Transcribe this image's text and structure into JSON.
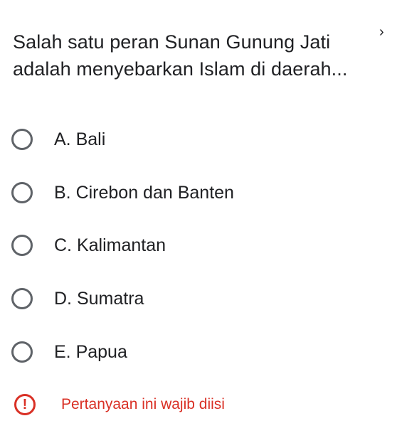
{
  "question": {
    "line1": "Salah satu peran Sunan Gunung Jati",
    "line2": "adalah menyebarkan Islam di daerah...",
    "mark": "›"
  },
  "options": [
    {
      "label": "A. Bali"
    },
    {
      "label": "B. Cirebon dan Banten"
    },
    {
      "label": "C. Kalimantan"
    },
    {
      "label": "D. Sumatra"
    },
    {
      "label": "E. Papua"
    }
  ],
  "validation": {
    "icon": "!",
    "message": "Pertanyaan ini wajib diisi"
  },
  "colors": {
    "error": "#d93025",
    "radio_border": "#5f6368",
    "text": "#202124"
  }
}
